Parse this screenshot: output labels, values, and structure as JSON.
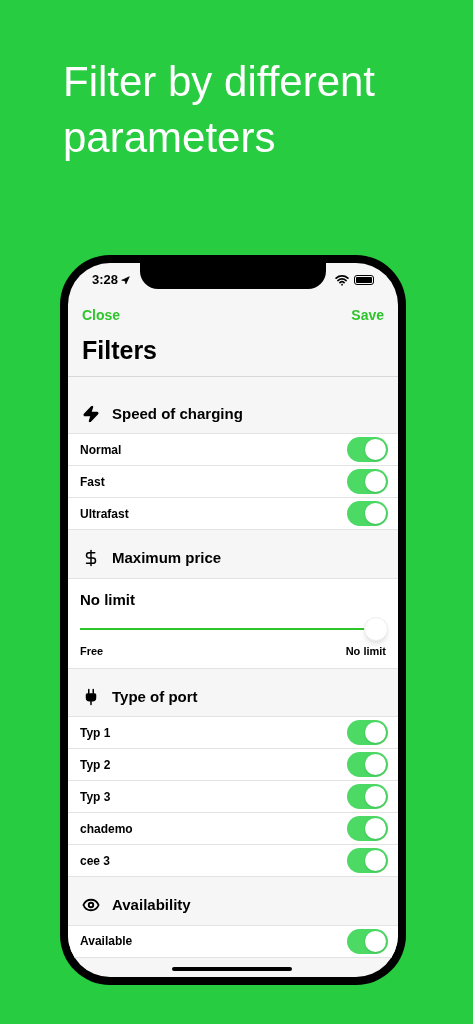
{
  "headline": "Filter by different parameters",
  "status_bar": {
    "time": "3:28"
  },
  "nav": {
    "left": "Close",
    "right": "Save",
    "title": "Filters"
  },
  "sections": [
    {
      "title": "Speed of charging",
      "kind": "toggles",
      "rows": [
        {
          "label": "Normal",
          "on": true
        },
        {
          "label": "Fast",
          "on": true
        },
        {
          "label": "Ultrafast",
          "on": true
        }
      ]
    },
    {
      "title": "Maximum price",
      "kind": "slider",
      "value": "No limit",
      "level": 1,
      "min_label": "Free",
      "max_label": "No limit"
    },
    {
      "title": "Type of port",
      "kind": "toggles",
      "rows": [
        {
          "label": "Typ 1",
          "on": true
        },
        {
          "label": "Typ 2",
          "on": true
        },
        {
          "label": "Typ 3",
          "on": true
        },
        {
          "label": "chademo",
          "on": true
        },
        {
          "label": "cee 3",
          "on": true
        }
      ]
    },
    {
      "title": "Availability",
      "kind": "toggles",
      "rows": [
        {
          "label": "Available",
          "on": true
        }
      ]
    }
  ]
}
